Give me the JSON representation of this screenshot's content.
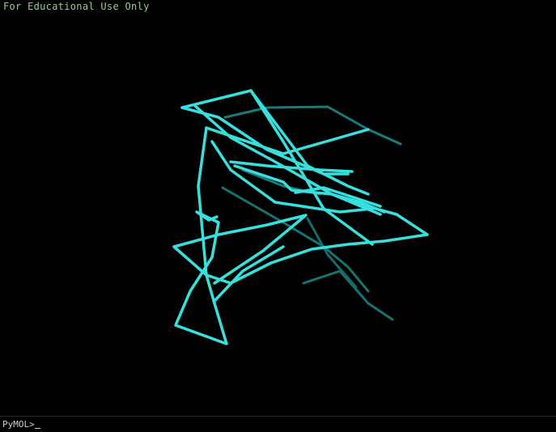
{
  "watermark": "For Educational Use Only",
  "command_line": {
    "prompt": "PyMOL>",
    "value": ""
  },
  "molecule": {
    "representation": "ribbon",
    "color": "#37e0dc",
    "shadow_color": "#1f8f8c"
  }
}
